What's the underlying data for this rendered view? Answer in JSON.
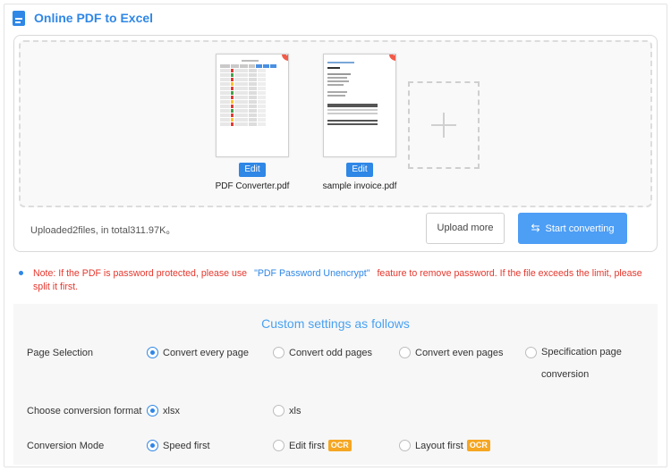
{
  "header": {
    "title": "Online PDF to Excel",
    "icon": "document-icon"
  },
  "upload": {
    "files": [
      {
        "name": "PDF Converter.pdf",
        "edit_label": "Edit",
        "remove_icon": "close-icon"
      },
      {
        "name": "sample invoice.pdf",
        "edit_label": "Edit",
        "remove_icon": "close-icon"
      }
    ],
    "add_icon": "plus-icon",
    "summary": "Uploaded2files, in total311.97K。",
    "upload_more_label": "Upload more",
    "start_label": "Start converting",
    "start_icon": "swap-arrows-icon"
  },
  "note": {
    "prefix": "Note: If the PDF is password protected, please use",
    "link": "\"PDF Password Unencrypt\"",
    "suffix": "feature to remove password. If the file exceeds the limit, please split it first."
  },
  "settings": {
    "title": "Custom settings as follows",
    "page_selection": {
      "label": "Page Selection",
      "options": [
        "Convert every page",
        "Convert odd pages",
        "Convert even pages",
        "Specification page conversion"
      ],
      "selected": 0
    },
    "format": {
      "label": "Choose conversion format",
      "options": [
        "xlsx",
        "xls"
      ],
      "selected": 0
    },
    "mode": {
      "label": "Conversion Mode",
      "options": [
        "Speed first",
        "Edit first",
        "Layout first"
      ],
      "badge": "OCR",
      "selected": 0
    }
  },
  "colors": {
    "accent": "#2f87e6",
    "danger": "#e5372d",
    "badge": "#f5a623",
    "button": "#4d9ef5"
  }
}
